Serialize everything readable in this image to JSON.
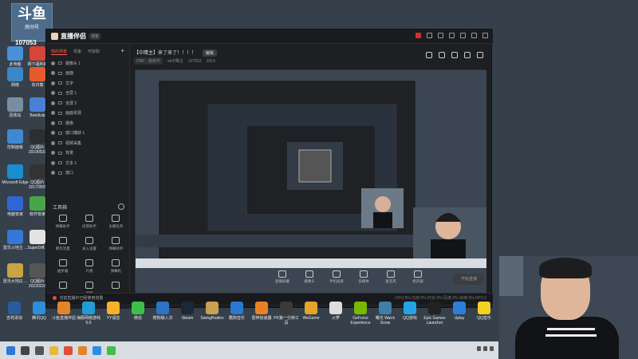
{
  "desktop": {
    "streamer_logo": "斗鱼",
    "streamer_caption": "房间号",
    "room_number": "107053",
    "left_icons": [
      {
        "label": "此电脑",
        "color": "#4a90d9"
      },
      {
        "label": "网下福利新",
        "color": "#d9443a"
      },
      {
        "label": "网络",
        "color": "#3b86c7"
      },
      {
        "label": "向日葵",
        "color": "#e85a2c"
      },
      {
        "label": "回收站",
        "color": "#7a8ea3"
      },
      {
        "label": "Bandizip",
        "color": "#4a7fd6"
      },
      {
        "label": "控制面板",
        "color": "#3e89d4"
      },
      {
        "label": "QQ图片 20190531",
        "color": "#2c2e31"
      },
      {
        "label": "Microsoft Edge",
        "color": "#1b8ed1"
      },
      {
        "label": "QQ图片 20170505",
        "color": "#333"
      },
      {
        "label": "电脑管家",
        "color": "#2f66d6"
      },
      {
        "label": "软件管家",
        "color": "#49a54a"
      },
      {
        "label": "雷沃斗地主 ...",
        "color": "#3477d6"
      },
      {
        "label": "SuperDiff...",
        "color": "#e3e3e3"
      },
      {
        "label": "雷沃大地瓜 ...",
        "color": "#c9a445"
      },
      {
        "label": "QQ图片 20220216",
        "color": "#555"
      }
    ]
  },
  "app": {
    "brand": "直播伴侣",
    "brand_pill": "浏览",
    "tabs": [
      {
        "label": "我的场景",
        "active": true
      },
      {
        "label": "现金",
        "active": false
      },
      {
        "label": "可获取",
        "active": false
      }
    ],
    "scenes": [
      "摄像头 1",
      "画面",
      "文字",
      "全屏 1",
      "全屏 2",
      "画面资源",
      "摄像",
      "窗口捕获 1",
      "视频采集",
      "背景",
      "文本 1",
      "窗口"
    ],
    "tools_title": "工具箱",
    "tools": [
      "弹幕助手",
      "房管助手",
      "主播任务",
      "网页流量",
      "录入设置",
      "弹幕助手",
      "抽奖箱",
      "礼物",
      "弹幕机",
      "",
      "视频",
      ""
    ],
    "stream_title": "【中鹰主】来了来了！！！！",
    "edit_label": "编辑",
    "meta_tag": "DNF - 游戏中",
    "meta_host": "ok中鹰主",
    "meta_room": "107053",
    "meta_viewers": "2014",
    "bottom_tools": [
      "直播屏幕",
      "摄像头",
      "手机投屏",
      "多媒体",
      "麦克风",
      "扬声器"
    ],
    "start_label": "开始直播",
    "status_notice": "当前直播中已经使用流量",
    "status_items": "CPU:9%  内存:5%  时长:0%  码率:0%  帧率:0%  FPS:0"
  },
  "bottom_icons": [
    {
      "label": "吉祥添加",
      "color": "#2b5b9f"
    },
    {
      "label": "腾讯QQ",
      "color": "#2d8ee0"
    },
    {
      "label": "斗鱼直播伴侣",
      "color": "#e3842b"
    },
    {
      "label": "海豚网络游戏5.0",
      "color": "#239bd6"
    },
    {
      "label": "YY语音",
      "color": "#f7b22a"
    },
    {
      "label": "微信",
      "color": "#3fbf4a"
    },
    {
      "label": "搜狗输入法",
      "color": "#2d73c8"
    },
    {
      "label": "Steam",
      "color": "#1b2838"
    },
    {
      "label": "SwingRudies",
      "color": "#c8a150"
    },
    {
      "label": "酷狗音乐",
      "color": "#2b77d4"
    },
    {
      "label": "雷神加速器",
      "color": "#e88125"
    },
    {
      "label": "PK第一分钟工具",
      "color": "#3a3a3a"
    },
    {
      "label": "WeGame",
      "color": "#e6a32c"
    },
    {
      "label": "火萝",
      "color": "#ddd"
    },
    {
      "label": "GeForce Experience",
      "color": "#76b900"
    },
    {
      "label": "曙光 Warm Snow",
      "color": "#3f7ea8"
    },
    {
      "label": "QQ游戏",
      "color": "#26a3e8"
    },
    {
      "label": "Epic Games Launcher",
      "color": "#222"
    },
    {
      "label": "Uplay",
      "color": "#2c7fd6"
    },
    {
      "label": "QQ音乐",
      "color": "#f4d11f"
    }
  ],
  "taskbar": {
    "icons": [
      "start",
      "search",
      "taskview",
      "explorer",
      "chrome",
      "douyu",
      "qq",
      "wechat"
    ]
  }
}
